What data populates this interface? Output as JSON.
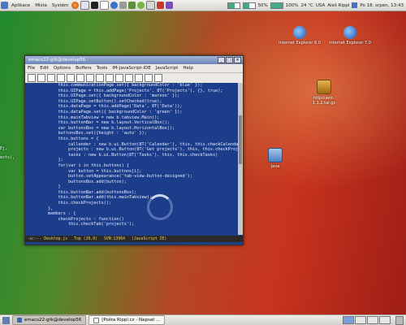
{
  "top_panel": {
    "menus": [
      "Aplikace",
      "Místa",
      "Systém"
    ],
    "tray": {
      "battery_text": "50%",
      "volume_text": "100%",
      "battery_level": 0.5,
      "volume_level": 1.0,
      "weather": "24 °C",
      "keyboard": "USA",
      "user": "Aleš Rippl",
      "clock": "Po 18. srpen, 13:43"
    }
  },
  "desktop_icons": [
    {
      "label": "Internet Explorer 6.0",
      "icon": "ie-icon"
    },
    {
      "label": "Internet Explorer 7.0",
      "icon": "ie-icon"
    },
    {
      "label": "httpclient-1.1.2.tar.gz",
      "icon": "archive-icon"
    },
    {
      "label": "java",
      "icon": "folder-icon"
    }
  ],
  "emacs": {
    "title": "emacs22-gtk@develop56",
    "menu": [
      "File",
      "Edit",
      "Options",
      "Buffers",
      "Tools",
      "IM-JavaScript-IDE",
      "JavaScript",
      "Help"
    ],
    "code_lines": [
      "    this.communicationPage.set({ backgroundColor : 'blue' });",
      "    this.UIPage = this.addPage('Projects', 8T('Projects'), {}, true);",
      "    this.UIPage.set({ backgroundColor : 'maroon' });",
      "    this.UIPage.setButton().setChecked(true);",
      "    this.dataPage = this.addPage('Data', 8T('Data'));",
      "    this.dataPage.set({ backgroundColor : 'green' });",
      "",
      "    this.mainTabview = new b.tabview.Main();",
      "",
      "    this.buttonBar = new b.layout.VerticalBox();",
      "",
      "    var buttonsBox = new b.layout.HorizontalBox();",
      "    buttonsBox.set({height : 'auto' });",
      "",
      "    this.buttons = {",
      "        callender : new b.ui.Button(8T('Calendar'), this, this.checkCalendar),",
      "",
      "        projects : new b.ui.Button(8T('Get projects'), this, this.checkProjects),",
      "",
      "        tasks : new b.ui.Button(8T('Tasks'), this, this.checkTasks)",
      "    };",
      "",
      "    for(var i in this.buttons) {",
      "        var button = this.buttons[i];",
      "        button.setAppearance('tab-view-button-designed');",
      "        buttonsBox.add(button);",
      "    }",
      "",
      "    this.buttonBar.add(buttonsBox);",
      "    this.buttonBar.add(this.mainTabview);",
      "    this.checkProjects();",
      "},",
      "",
      "members : {",
      "",
      "    checkProjects : function()",
      "",
      "        this.checkTab('projects');"
    ],
    "side_notes": [
      "Ej,",
      "ests),"
    ],
    "modeline": [
      "-u:--- Desktop.js",
      "Top (20,0)",
      "SVN:13964",
      "(JavaScript IE)"
    ]
  },
  "taskbar": {
    "items": [
      {
        "label": "emacs22-gtk@develop56",
        "active": true
      },
      {
        "label": "[Pošta Rippl.cz - Napsat ...",
        "active": false
      }
    ]
  }
}
